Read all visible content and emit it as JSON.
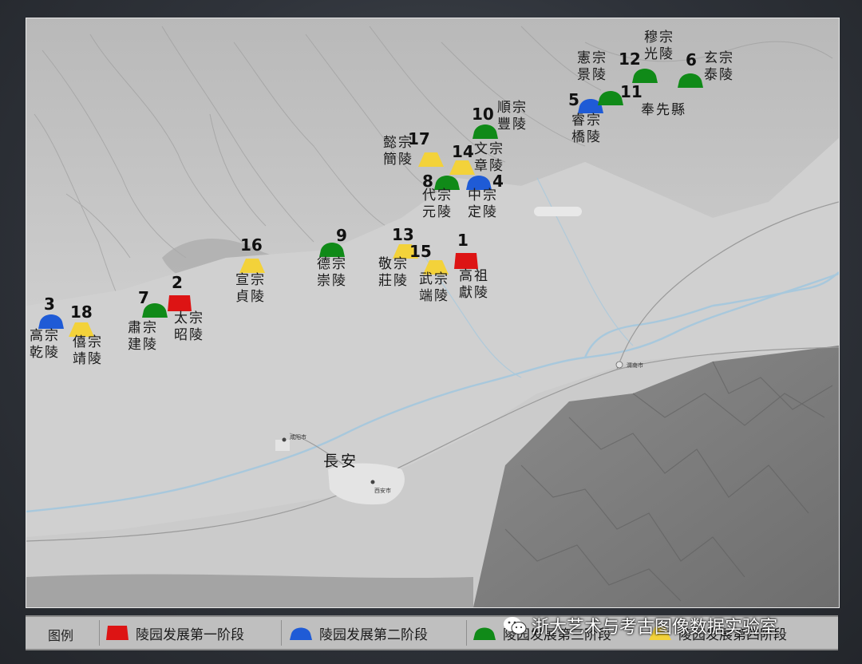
{
  "colors": {
    "phase1": "#dd1414",
    "phase2": "#1f5bd6",
    "phase3": "#108a18",
    "phase4": "#f3d23a",
    "river": "#9fc4dc"
  },
  "map": {
    "capital_label": "長安",
    "cities": [
      "西安市",
      "咸阳市",
      "渭南市"
    ],
    "district_label": "奉先縣",
    "tombs": [
      {
        "num": "1",
        "phase": 1,
        "label_lines": [
          "高祖",
          "獻陵"
        ]
      },
      {
        "num": "2",
        "phase": 1,
        "label_lines": [
          "太宗",
          "昭陵"
        ]
      },
      {
        "num": "3",
        "phase": 2,
        "label_lines": [
          "高宗",
          "乾陵"
        ]
      },
      {
        "num": "4",
        "phase": 2,
        "label_lines": [
          "中宗",
          "定陵"
        ]
      },
      {
        "num": "5",
        "phase": 2,
        "label_lines": [
          "睿宗",
          "橋陵"
        ]
      },
      {
        "num": "6",
        "phase": 3,
        "label_lines": [
          "玄宗",
          "泰陵"
        ]
      },
      {
        "num": "7",
        "phase": 3,
        "label_lines": [
          "肅宗",
          "建陵"
        ]
      },
      {
        "num": "8",
        "phase": 3,
        "label_lines": [
          "代宗",
          "元陵"
        ]
      },
      {
        "num": "9",
        "phase": 3,
        "label_lines": [
          "德宗",
          "崇陵"
        ]
      },
      {
        "num": "10",
        "phase": 3,
        "label_lines": [
          "順宗",
          "豐陵"
        ]
      },
      {
        "num": "11",
        "phase": 3,
        "label_lines": [
          "憲宗",
          "景陵"
        ]
      },
      {
        "num": "12",
        "phase": 3,
        "label_lines": [
          "穆宗",
          "光陵"
        ]
      },
      {
        "num": "13",
        "phase": 4,
        "label_lines": [
          "敬宗",
          "莊陵"
        ]
      },
      {
        "num": "14",
        "phase": 4,
        "label_lines": [
          "文宗",
          "章陵"
        ]
      },
      {
        "num": "15",
        "phase": 4,
        "label_lines": [
          "武宗",
          "端陵"
        ]
      },
      {
        "num": "16",
        "phase": 4,
        "label_lines": [
          "宣宗",
          "貞陵"
        ]
      },
      {
        "num": "17",
        "phase": 4,
        "label_lines": [
          "懿宗",
          "簡陵"
        ]
      },
      {
        "num": "18",
        "phase": 4,
        "label_lines": [
          "僖宗",
          "靖陵"
        ]
      }
    ]
  },
  "legend": {
    "title": "图例",
    "items": [
      "陵园发展第一阶段",
      "陵园发展第二阶段",
      "陵园发展第三阶段",
      "陵园发展第四阶段"
    ]
  },
  "watermark": "浙大艺术与考古图像数据实验室"
}
